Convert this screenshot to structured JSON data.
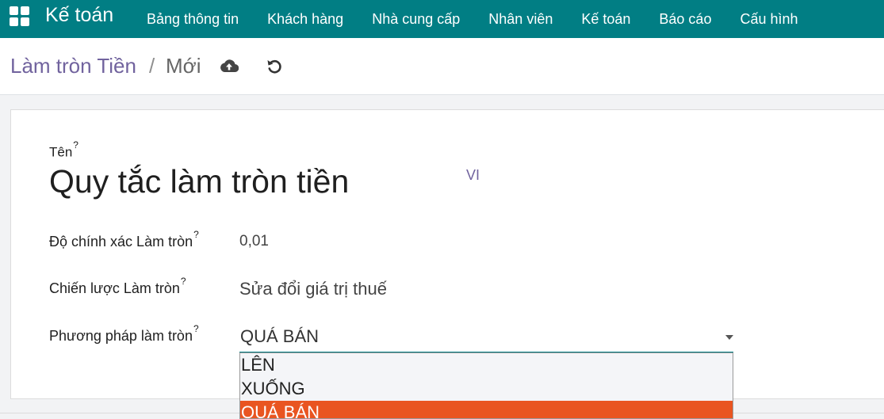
{
  "topbar": {
    "app_name": "Kế toán",
    "menu": [
      "Bảng thông tin",
      "Khách hàng",
      "Nhà cung cấp",
      "Nhân viên",
      "Kế toán",
      "Báo cáo",
      "Cấu hình"
    ]
  },
  "breadcrumb": {
    "root": "Làm tròn Tiền",
    "separator": "/",
    "current": "Mới"
  },
  "icons": {
    "apps": "grid-icon",
    "save": "cloud-upload-icon",
    "discard": "undo-icon",
    "dropdown": "caret-down-icon"
  },
  "form": {
    "name_label": "Tên",
    "help_mark": "?",
    "name_value": "Quy tắc làm tròn tiền",
    "lang": "VI",
    "precision_label": "Độ chính xác Làm tròn",
    "precision_value": "0,01",
    "strategy_label": "Chiến lược Làm tròn",
    "strategy_value": "Sửa đổi giá trị thuế",
    "method_label": "Phương pháp làm tròn",
    "method_value": "QUÁ BÁN",
    "method_options": [
      "LÊN",
      "XUỐNG",
      "QUÁ BÁN"
    ],
    "method_selected": "QUÁ BÁN"
  },
  "colors": {
    "topbar": "#017e84",
    "brand_text": "#71639e",
    "selected_option": "#e95521"
  }
}
